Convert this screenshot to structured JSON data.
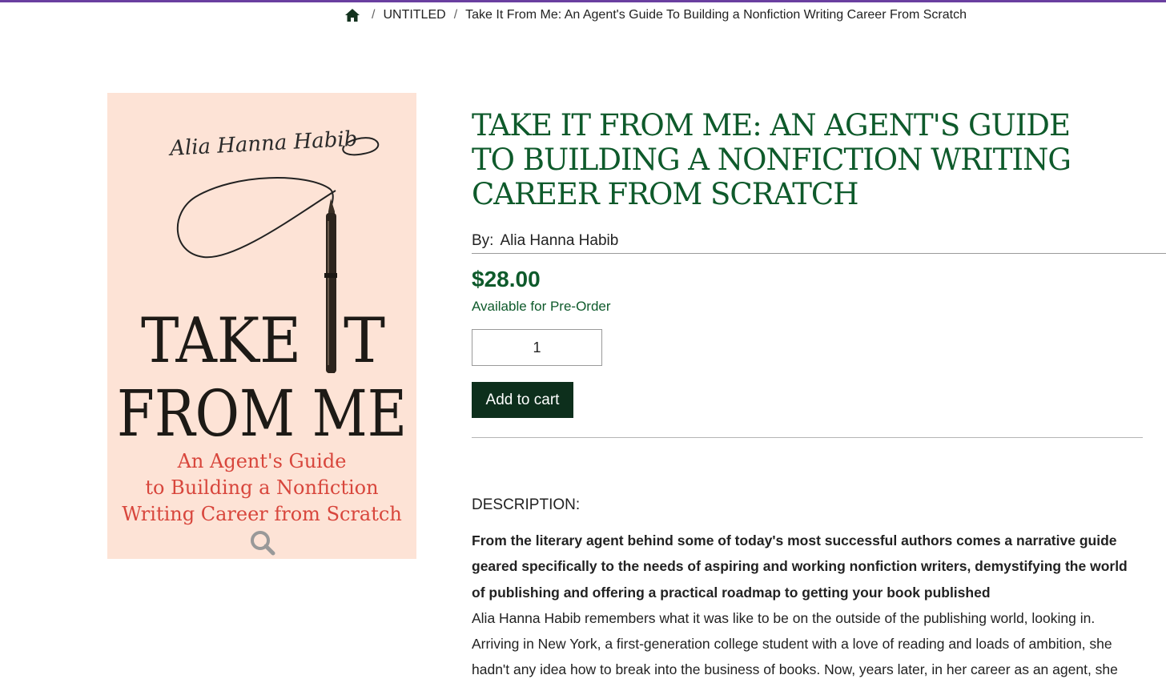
{
  "breadcrumb": {
    "home_icon": "home-icon",
    "separator": "/",
    "items": [
      "UNTITLED",
      "Take It From Me: An Agent's Guide To Building a Nonfiction Writing Career From Scratch"
    ]
  },
  "cover": {
    "signature": "Alia Hanna Habib",
    "title_line1": "TAKE",
    "title_line1b": "T",
    "title_line2": "FROM ME",
    "subtitle": [
      "An Agent's Guide",
      "to Building a Nonfiction",
      "Writing Career from Scratch"
    ],
    "zoom_icon": "magnifier-icon"
  },
  "product": {
    "title": "TAKE IT FROM ME: AN AGENT'S GUIDE TO BUILDING A NONFICTION WRITING CAREER FROM SCRATCH",
    "by_label": "By:",
    "author": "Alia Hanna Habib",
    "price": "$28.00",
    "availability": "Available for Pre-Order",
    "quantity": "1",
    "add_to_cart": "Add to cart"
  },
  "description": {
    "heading": "DESCRIPTION:",
    "lead": "From the literary agent behind some of today's most successful authors comes a narrative guide geared specifically to the needs of aspiring and working nonfiction writers, demystifying the world of publishing and offering a practical roadmap to getting your book published",
    "body": "Alia Hanna Habib remembers what it was like to be on the outside of the publishing world, looking in. Arriving in New York, a first-generation college student with a love of reading and loads of ambition, she hadn't any idea how to break into the business of books. Now, years later, in her career as an agent, she"
  },
  "colors": {
    "accent_green": "#0e5a2b",
    "button_bg": "#0d2f1c",
    "top_bar": "#6a3fa0",
    "cover_bg": "#fde3d6",
    "cover_subtitle": "#d8463c"
  }
}
